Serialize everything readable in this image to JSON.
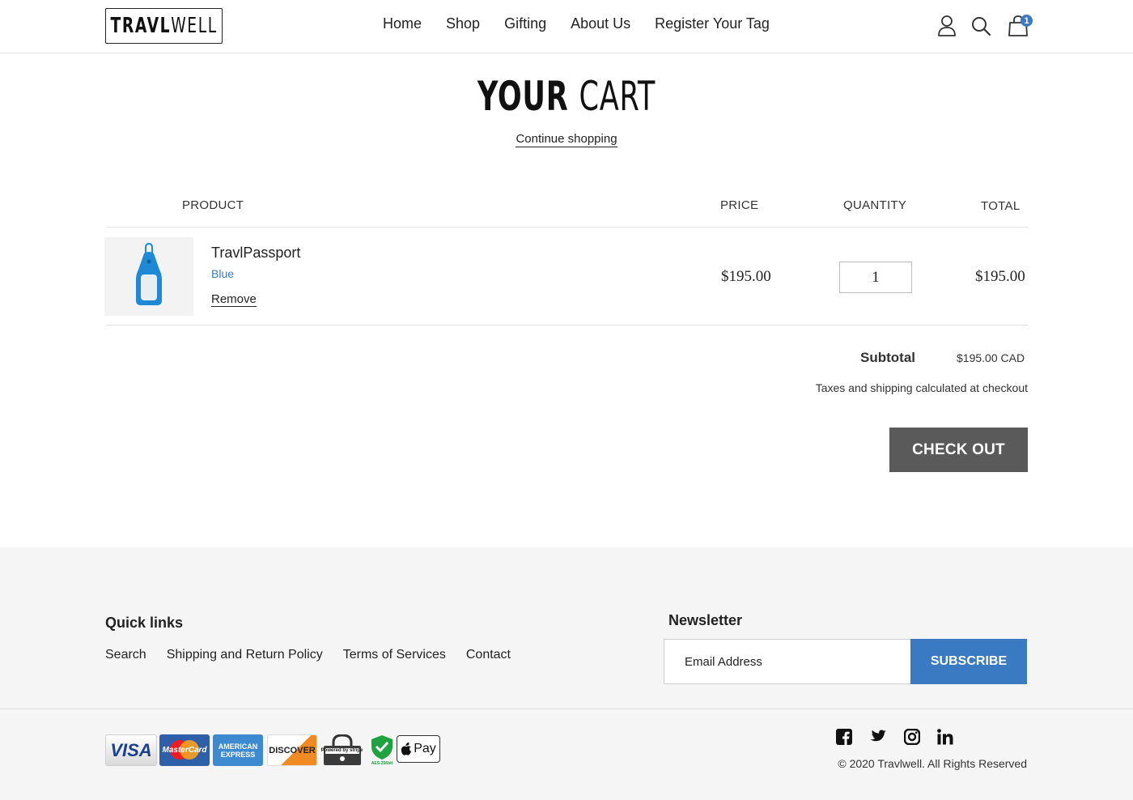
{
  "header": {
    "logo": {
      "part1": "TRAVL",
      "part2": "WELL"
    },
    "nav": [
      {
        "label": "Home"
      },
      {
        "label": "Shop"
      },
      {
        "label": "Gifting"
      },
      {
        "label": "About Us"
      },
      {
        "label": "Register Your Tag"
      }
    ],
    "icons": [
      "account-icon",
      "search-icon",
      "cart-icon"
    ],
    "cart_count": "1"
  },
  "cart": {
    "title_bold": "YOUR",
    "title_light": "CART",
    "continue_label": "Continue shopping",
    "columns": {
      "product": "PRODUCT",
      "price": "PRICE",
      "quantity": "QUANTITY",
      "total": "TOTAL"
    },
    "items": [
      {
        "name": "TravlPassport",
        "variant": "Blue",
        "remove_label": "Remove",
        "price": "$195.00",
        "quantity": "1",
        "total": "$195.00",
        "image_icon": "luggage-tag-icon"
      }
    ],
    "subtotal_label": "Subtotal",
    "subtotal_value": "$195.00 CAD",
    "tax_note": "Taxes and shipping calculated at checkout",
    "checkout_label": "CHECK OUT"
  },
  "footer": {
    "quick_links_title": "Quick links",
    "quick_links": [
      {
        "label": "Search"
      },
      {
        "label": "Shipping and Return Policy"
      },
      {
        "label": "Terms of Services"
      },
      {
        "label": "Contact"
      }
    ],
    "newsletter_title": "Newsletter",
    "email_placeholder": "Email Address",
    "subscribe_label": "SUBSCRIBE",
    "payment_badges": [
      {
        "icon": "visa-icon",
        "label": "VISA"
      },
      {
        "icon": "mastercard-icon",
        "label": "MasterCard"
      },
      {
        "icon": "amex-icon",
        "label": "AMERICAN EXPRESS"
      },
      {
        "icon": "discover-icon",
        "label": "DISCOVER"
      },
      {
        "icon": "stripe-secure-icon",
        "label": "Powered by stripe"
      },
      {
        "icon": "aes-shield-icon",
        "label": "AES-256bit"
      },
      {
        "icon": "apple-pay-icon",
        "label": "Pay"
      }
    ],
    "social": [
      "facebook-icon",
      "twitter-icon",
      "instagram-icon",
      "linkedin-icon"
    ],
    "copyright": "© 2020 Travlwell. All Rights Reserved"
  },
  "colors": {
    "accent": "#3a7ac2",
    "checkout_bg": "#5a5a5a",
    "footer_bg": "#f5f5f5",
    "text": "#222222"
  }
}
